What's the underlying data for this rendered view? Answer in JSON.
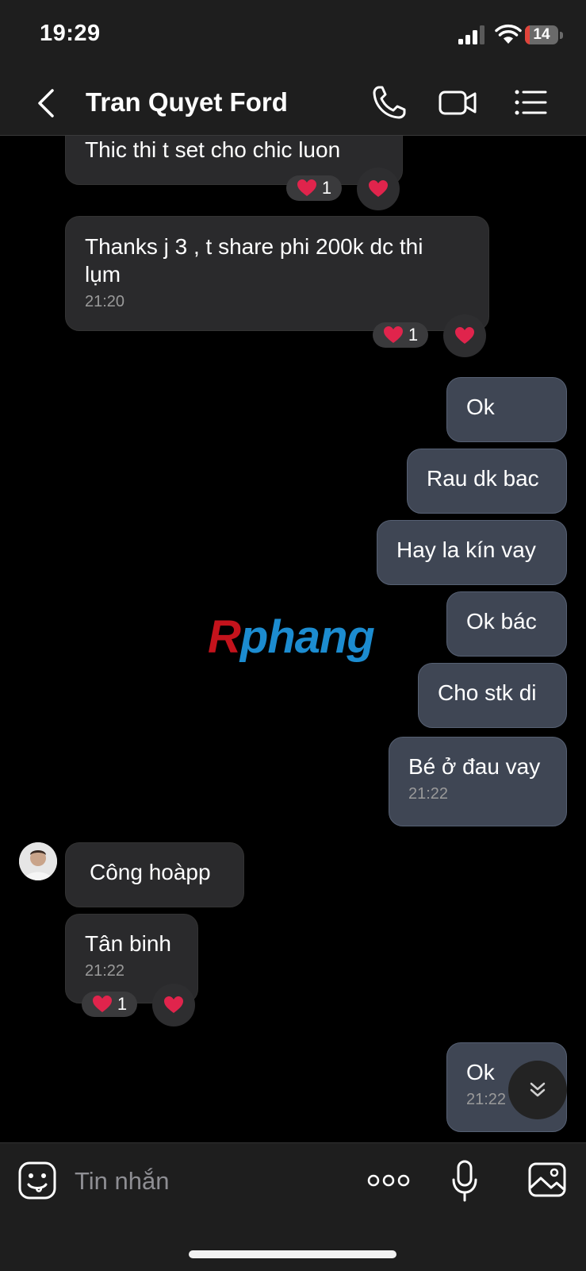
{
  "status_bar": {
    "time": "19:29",
    "battery": "14",
    "battery_level": 0.14,
    "battery_color": "#e0443b"
  },
  "header": {
    "contact_name": "Tran Quyet Ford",
    "icons": [
      "back-icon",
      "phone-icon",
      "video-call-icon",
      "menu-list-icon"
    ]
  },
  "messages": [
    {
      "direction": "incoming",
      "text": "Thic thi t set cho chic luon",
      "reaction": {
        "emoji": "heart",
        "count": "1"
      }
    },
    {
      "direction": "incoming",
      "text_line1": "Thanks j 3 , t share phi 200k dc thi",
      "text_line2": "lụm",
      "time": "21:20",
      "reaction": {
        "emoji": "heart",
        "count": "1"
      }
    },
    {
      "direction": "outgoing",
      "text": "Ok"
    },
    {
      "direction": "outgoing",
      "text": "Rau dk bac"
    },
    {
      "direction": "outgoing",
      "text": "Hay la kín vay"
    },
    {
      "direction": "outgoing",
      "text": "Ok bác"
    },
    {
      "direction": "outgoing",
      "text": "Cho stk di"
    },
    {
      "direction": "outgoing",
      "text": "Bé ở đau vay",
      "time": "21:22"
    },
    {
      "direction": "incoming",
      "text": "Công hoàpp"
    },
    {
      "direction": "incoming",
      "text": "Tân binh",
      "time": "21:22",
      "reaction": {
        "emoji": "heart",
        "count": "1"
      }
    },
    {
      "direction": "outgoing",
      "text": "Ok",
      "time": "21:22"
    }
  ],
  "watermark": {
    "part1": "R",
    "part2": "phang"
  },
  "input": {
    "placeholder": "Tin nhắn",
    "icons": [
      "sticker-icon",
      "more-icon",
      "microphone-icon",
      "image-icon"
    ]
  },
  "colors": {
    "outgoing_bubble": "#3f4654",
    "incoming_bubble": "#2a2a2c",
    "heart": "#e0244c",
    "background": "#000000"
  }
}
